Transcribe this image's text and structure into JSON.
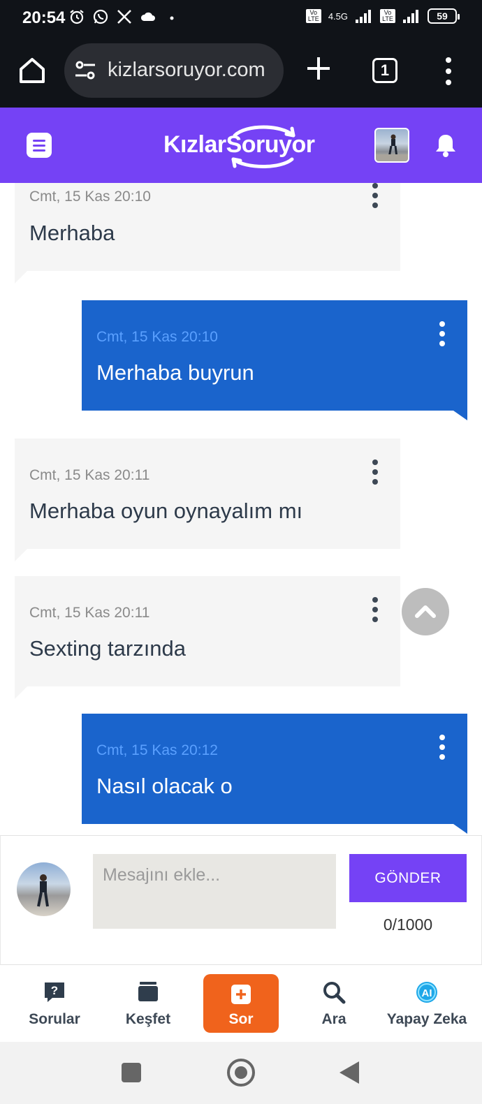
{
  "status_bar": {
    "time": "20:54",
    "network_label": "4.5G",
    "volte_label": "Vo LTE",
    "battery": "59",
    "icons": [
      "alarm-icon",
      "whatsapp-icon",
      "x-icon",
      "cloud-icon",
      "dot-icon",
      "signal-icon",
      "battery-icon"
    ]
  },
  "browser": {
    "url": "kizlarsoruyor.com",
    "tab_count": "1",
    "icons": [
      "home-icon",
      "site-settings-icon",
      "new-tab-icon",
      "tabs-icon",
      "more-vert-icon"
    ]
  },
  "header": {
    "logo": "KızlarSoruyor",
    "icons": [
      "menu-icon",
      "avatar",
      "bell-icon"
    ],
    "colors": {
      "brand": "#7542f5"
    }
  },
  "messages": [
    {
      "direction": "in",
      "time": "Cmt, 15 Kas 20:10",
      "text": "Merhaba"
    },
    {
      "direction": "out",
      "time": "Cmt, 15 Kas 20:10",
      "text": "Merhaba buyrun"
    },
    {
      "direction": "in",
      "time": "Cmt, 15 Kas 20:11",
      "text": "Merhaba oyun oynayalım mı"
    },
    {
      "direction": "in",
      "time": "Cmt, 15 Kas 20:11",
      "text": "Sexting tarzında"
    },
    {
      "direction": "out",
      "time": "Cmt, 15 Kas 20:12",
      "text": "Nasıl olacak o"
    }
  ],
  "composer": {
    "placeholder": "Mesajını ekle...",
    "value": "",
    "send_label": "GÖNDER",
    "counter": "0/1000"
  },
  "bottom_nav": {
    "items": [
      {
        "label": "Sorular",
        "icon": "question-bubble-icon"
      },
      {
        "label": "Keşfet",
        "icon": "cards-icon"
      },
      {
        "label": "Sor",
        "icon": "add-square-icon"
      },
      {
        "label": "Ara",
        "icon": "search-icon"
      },
      {
        "label": "Yapay Zeka",
        "icon": "ai-icon"
      }
    ],
    "ai_badge": "AI",
    "colors": {
      "sor_bg": "#f0631c",
      "ai": "#1ea7e8"
    }
  },
  "colors": {
    "incoming_bubble": "#f5f5f5",
    "outgoing_bubble": "#1a64cc",
    "send_button": "#7542f5"
  }
}
